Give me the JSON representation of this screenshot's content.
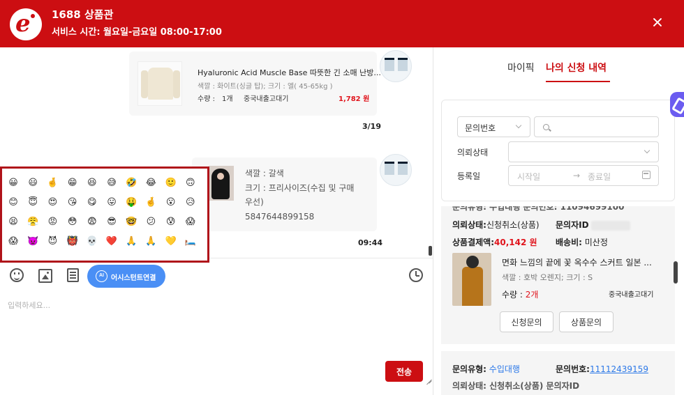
{
  "header": {
    "title": "1688 상품관",
    "service_hours": "서비스 시간: 월요일-금요일 08:00-17:00",
    "logo_icon": "brand-e-logo",
    "brand_color": "#cc0e12"
  },
  "chat": {
    "message1": {
      "title": "Hyaluronic Acid Muscle Base 따뜻한 긴 소매 난방...",
      "spec": "색깔 : 화이트(싱글 탑); 크기 : 엘( 45-65kg )",
      "qty_label": "수량 :",
      "qty": "1개",
      "shipping": "중국내출고대기",
      "price": "1,782 원",
      "stamp": "3/19"
    },
    "message2": {
      "color": "색깔 : 갈색",
      "size_line1": "크기 : 프리사이즈(수집 및 구매",
      "size_line2": "우선)",
      "code": "5847644899158",
      "stamp": "09:44"
    },
    "emojis": [
      "😀",
      "😃",
      "🤞",
      "😁",
      "😆",
      "😅",
      "🤣",
      "😂",
      "🙂",
      "🙃",
      "😊",
      "😇",
      "😍",
      "😘",
      "😋",
      "😛",
      "🤑",
      "🤞",
      "😮",
      "😥",
      "😫",
      "😤",
      "😡",
      "😳",
      "😨",
      "😎",
      "🤓",
      "😕",
      "😰",
      "😱",
      "😱",
      "👿",
      "😈",
      "👹",
      "💀",
      "❤️",
      "🙏",
      "🙏",
      "💛",
      "🛏️"
    ],
    "toolbar": {
      "assist_label": "어시스턴트연결",
      "assist_icon_text": "AI"
    },
    "input_placeholder": "입력하세요...",
    "send_label": "전송"
  },
  "right_panel": {
    "tabs": [
      {
        "label": "마이픽"
      },
      {
        "label": "나의 신청 내역"
      }
    ],
    "filter": {
      "type_select": "문의번호",
      "status_label": "의뢰상태",
      "date_label": "등록일",
      "date_start_placeholder": "시작일",
      "date_end_placeholder": "종료일",
      "arrow": "→"
    },
    "card1": {
      "top_partial": "문의유형: 수입대행     문의번호: 11094699100",
      "status_label": "의뢰상태:",
      "status": "신청취소(상품)",
      "requester_label": "문의자ID",
      "payment_label": "상품결제액:",
      "payment": "40,142 원",
      "shipping_fee_label": "배송비:",
      "shipping_fee": "미산정",
      "item_title": "면화 느낌의 끝에 꽃 옥수수 스커트 일본 ...",
      "item_spec": "색깔 : 호박 오렌지;  크기 : S",
      "item_qty_label": "수량 :",
      "item_qty": "2개",
      "item_shipping": "중국내출고대기",
      "btn_request": "신청문의",
      "btn_product": "상품문의"
    },
    "card2": {
      "type_label": "문의유형:",
      "type": "수입대행",
      "no_label": "문의번호:",
      "no": "11112439159",
      "status_partial": "의뢰상태: 신청취소(상품)     문의자ID"
    }
  }
}
